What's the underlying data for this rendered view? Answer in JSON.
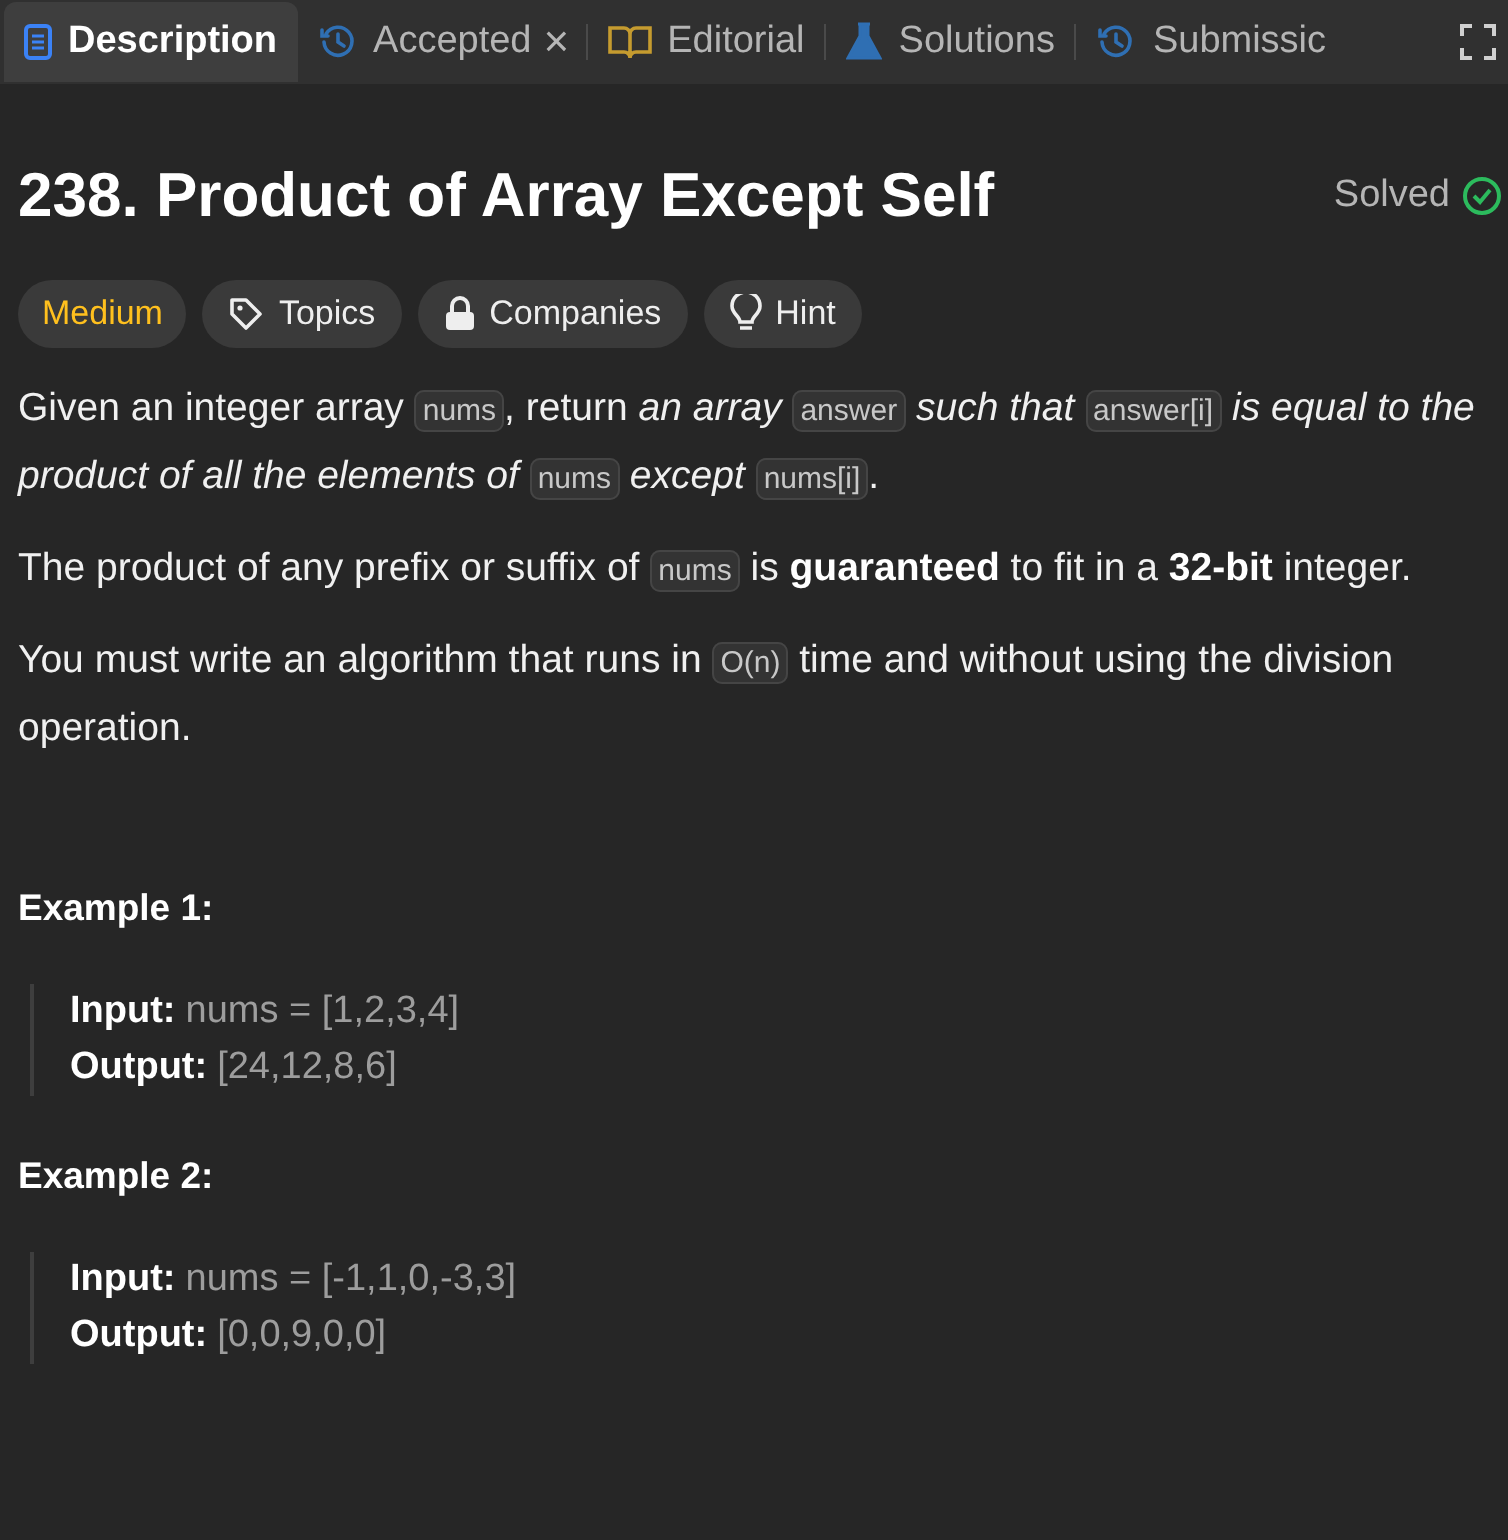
{
  "tabs": [
    {
      "label": "Description",
      "kind": "doc",
      "selected": true,
      "closable": false
    },
    {
      "label": "Accepted",
      "kind": "history",
      "selected": false,
      "closable": true,
      "close": "×"
    },
    {
      "label": "Editorial",
      "kind": "book",
      "selected": false,
      "closable": false
    },
    {
      "label": "Solutions",
      "kind": "flask",
      "selected": false,
      "closable": false
    },
    {
      "label": "Submissic",
      "kind": "history",
      "selected": false,
      "closable": false
    }
  ],
  "title": "238. Product of Array Except Self",
  "status": {
    "label": "Solved",
    "solved": true
  },
  "tags": [
    {
      "label": "Medium",
      "kind": "difficulty"
    },
    {
      "label": "Topics",
      "kind": "tag"
    },
    {
      "label": "Companies",
      "kind": "lock"
    },
    {
      "label": "Hint",
      "kind": "bulb"
    }
  ],
  "paragraphs": [
    [
      {
        "kind": "text",
        "text": "Given an integer array "
      },
      {
        "kind": "code",
        "text": "nums"
      },
      {
        "kind": "text",
        "text": ", return "
      },
      {
        "kind": "italic",
        "text": "an array "
      },
      {
        "kind": "code",
        "text": "answer"
      },
      {
        "kind": "italic",
        "text": " such that "
      },
      {
        "kind": "code",
        "text": "answer[i]"
      },
      {
        "kind": "italic",
        "text": " is equal to the product of all the elements of "
      },
      {
        "kind": "code",
        "text": "nums"
      },
      {
        "kind": "italic",
        "text": " except "
      },
      {
        "kind": "code",
        "text": "nums[i]"
      },
      {
        "kind": "text",
        "text": "."
      }
    ],
    [
      {
        "kind": "text",
        "text": "The product of any prefix or suffix of "
      },
      {
        "kind": "code",
        "text": "nums"
      },
      {
        "kind": "text",
        "text": " is "
      },
      {
        "kind": "bold",
        "text": "guaranteed"
      },
      {
        "kind": "text",
        "text": " to fit in a "
      },
      {
        "kind": "bold",
        "text": "32-bit"
      },
      {
        "kind": "text",
        "text": " integer."
      }
    ],
    [
      {
        "kind": "text",
        "text": "You must write an algorithm that runs in "
      },
      {
        "kind": "code",
        "text": "O(n)"
      },
      {
        "kind": "text",
        "text": " time and without using the division operation."
      }
    ]
  ],
  "examples": [
    {
      "heading": "Example 1:",
      "lines": [
        {
          "label": "Input:",
          "value": "nums = [1,2,3,4]"
        },
        {
          "label": "Output:",
          "value": "[24,12,8,6]"
        }
      ]
    },
    {
      "heading": "Example 2:",
      "lines": [
        {
          "label": "Input:",
          "value": "nums = [-1,1,0,-3,3]"
        },
        {
          "label": "Output:",
          "value": "[0,0,9,0,0]"
        }
      ]
    }
  ]
}
